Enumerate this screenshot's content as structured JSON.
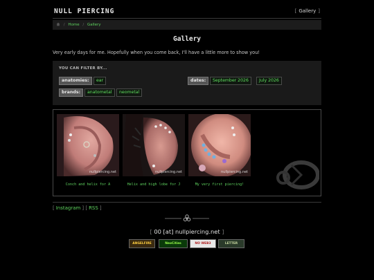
{
  "site": {
    "title": "NULL PIERCING"
  },
  "nav": {
    "items": [
      "Gallery"
    ]
  },
  "breadcrumb": {
    "home_icon": "home-icon",
    "items": [
      "Home",
      "Gallery"
    ]
  },
  "page": {
    "title": "Gallery",
    "intro": "Very early days for me. Hopefully when you come back, I'll have a little more to show you!"
  },
  "filter": {
    "heading": "YOU CAN FILTER BY...",
    "anatomies_label": "anatomies:",
    "anatomies": [
      "ear"
    ],
    "brands_label": "brands:",
    "brands": [
      "anatometal",
      "neometal"
    ],
    "dates_label": "dates:",
    "dates": [
      "September 2026",
      "July 2026"
    ]
  },
  "gallery": {
    "watermark": "nullpiercing.net",
    "items": [
      {
        "caption": "Conch and helix for A"
      },
      {
        "caption": "Helix and high lobe for J"
      },
      {
        "caption": "My very first piercing!"
      }
    ]
  },
  "social": {
    "links": [
      "Instagram",
      "RSS"
    ]
  },
  "footer": {
    "divider_icon": "biohazard-icon",
    "email": "00 [at] nullpiercing.net",
    "badges": [
      "ANGELFIRE",
      "NeoCities",
      "NO WEB3",
      "LETTER"
    ]
  },
  "colors": {
    "accent": "#5fd35f",
    "background": "#000000",
    "panel": "#1a1a1a"
  }
}
